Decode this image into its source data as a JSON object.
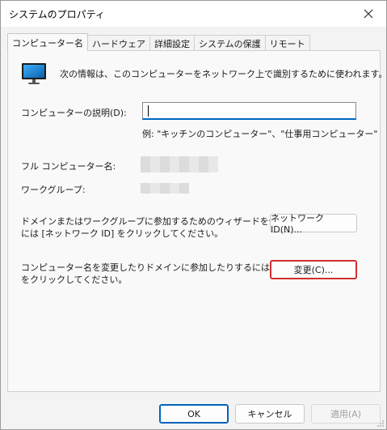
{
  "window": {
    "title": "システムのプロパティ"
  },
  "tabs": [
    {
      "label": "コンピューター名",
      "active": true
    },
    {
      "label": "ハードウェア",
      "active": false
    },
    {
      "label": "詳細設定",
      "active": false
    },
    {
      "label": "システムの保護",
      "active": false
    },
    {
      "label": "リモート",
      "active": false
    }
  ],
  "computer_name_tab": {
    "intro_text": "次の情報は、このコンピューターをネットワーク上で識別するために使われます。",
    "description_label": "コンピューターの説明(D):",
    "description_value": "",
    "example_text": "例: \"キッチンのコンピューター\"、\"仕事用コンピューター\"",
    "full_name_label": "フル コンピューター名:",
    "workgroup_label": "ワークグループ:",
    "network_id_text_line1": "ドメインまたはワークグループに参加するためのウィザードを使用する",
    "network_id_text_line2": "には [ネットワーク ID] をクリックしてください。",
    "network_id_button": "ネットワーク ID(N)...",
    "change_text_line1": "コンピューター名を変更したりドメインに参加したりするには [変更]",
    "change_text_line2": "をクリックしてください。",
    "change_button": "変更(C)..."
  },
  "footer": {
    "ok": "OK",
    "cancel": "キャンセル",
    "apply": "適用(A)"
  },
  "colors": {
    "accent": "#0067c0",
    "highlight": "#d32f2f"
  },
  "icons": {
    "computer": "monitor-icon",
    "close": "close-icon"
  }
}
